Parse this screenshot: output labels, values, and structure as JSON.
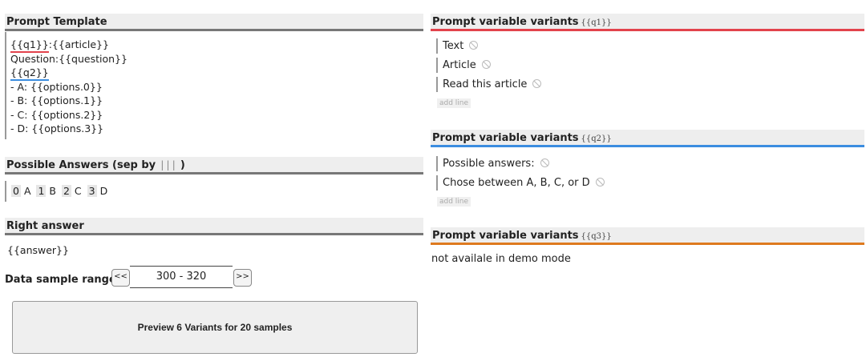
{
  "template": {
    "header": "Prompt Template",
    "line1_var": "{{q1}}",
    "line1_rest": ":{{article}}",
    "line2": "Question:{{question}}",
    "line3_var": "{{q2}}",
    "line4": "- A: {{options.0}}",
    "line5": "- B: {{options.1}}",
    "line6": "- C: {{options.2}}",
    "line7": "- D: {{options.3}}"
  },
  "answers": {
    "header": "Possible Answers (sep by",
    "sep": "|||",
    "header_end": ")",
    "items": [
      {
        "key": "0",
        "value": "A"
      },
      {
        "key": "1",
        "value": "B"
      },
      {
        "key": "2",
        "value": "C"
      },
      {
        "key": "3",
        "value": "D"
      }
    ]
  },
  "right_answer": {
    "header": "Right answer",
    "value": "{{answer}}"
  },
  "range": {
    "label": "Data sample range:",
    "prev": "<<",
    "value": "300 - 320",
    "next": ">>"
  },
  "preview_button": "Preview 6 Variants for 20 samples",
  "variants": [
    {
      "header": "Prompt variable variants",
      "var": "{{q1}}",
      "color": "#e2434c",
      "lines": [
        "Text",
        "Article",
        "Read this article"
      ],
      "add_line": "add line"
    },
    {
      "header": "Prompt variable variants",
      "var": "{{q2}}",
      "color": "#3b8de0",
      "lines": [
        "Possible answers:",
        "Chose between A, B, C, or D"
      ],
      "add_line": "add line"
    },
    {
      "header": "Prompt variable variants",
      "var": "{{q3}}",
      "color": "#de7a1f",
      "note": "not availale in demo mode"
    }
  ],
  "icons": {
    "remove": "ban-icon"
  }
}
